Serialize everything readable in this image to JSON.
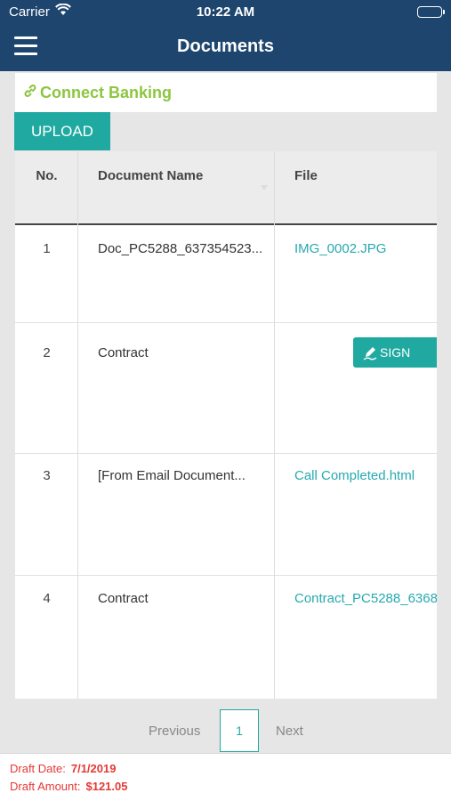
{
  "status_bar": {
    "carrier": "Carrier",
    "time": "10:22 AM"
  },
  "nav": {
    "title": "Documents"
  },
  "connect": {
    "label": "Connect Banking",
    "color": "#8cc63f"
  },
  "upload": {
    "label": "UPLOAD"
  },
  "table": {
    "headers": {
      "no": "No.",
      "name": "Document Name",
      "file": "File"
    },
    "rows": [
      {
        "no": "1",
        "name": "Doc_PC5288_637354523...",
        "file": "IMG_0002.JPG"
      },
      {
        "no": "2",
        "name": "Contract",
        "file": "",
        "action": "SIGN"
      },
      {
        "no": "3",
        "name": "[From Email Document...",
        "file": "Call Completed.html"
      },
      {
        "no": "4",
        "name": "Contract",
        "file": "Contract_PC5288_6368"
      }
    ]
  },
  "pagination": {
    "previous": "Previous",
    "current": "1",
    "next": "Next"
  },
  "footer": {
    "draft_date_label": "Draft Date:",
    "draft_date_value": "7/1/2019",
    "draft_amount_label": "Draft Amount:",
    "draft_amount_value": "$121.05"
  },
  "colors": {
    "nav": "#1e456e",
    "accent": "#1fa9a0",
    "link": "#26a9b0",
    "footer_text": "#e53935"
  },
  "icons": [
    "wifi-icon",
    "battery-icon",
    "menu-icon",
    "link-icon",
    "pen-icon"
  ]
}
